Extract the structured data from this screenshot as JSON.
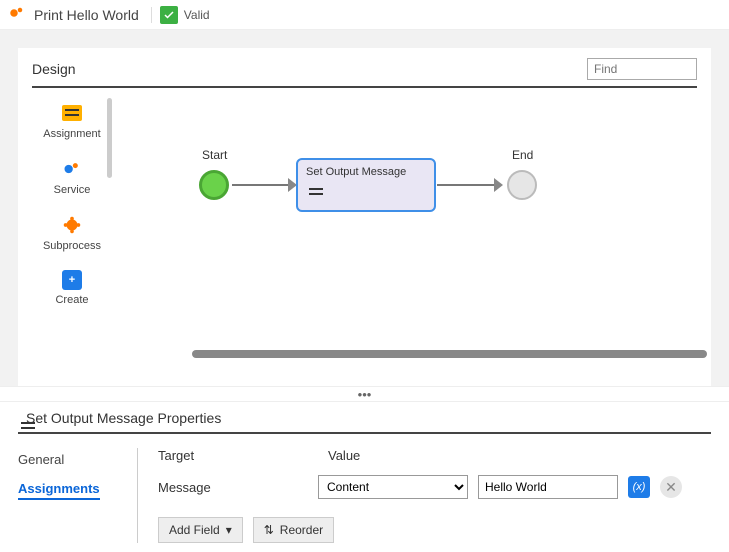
{
  "header": {
    "title": "Print Hello World",
    "valid_label": "Valid"
  },
  "design": {
    "title": "Design",
    "find_placeholder": "Find",
    "palette": [
      {
        "id": "assignment",
        "label": "Assignment"
      },
      {
        "id": "service",
        "label": "Service"
      },
      {
        "id": "subprocess",
        "label": "Subprocess"
      },
      {
        "id": "create",
        "label": "Create"
      }
    ],
    "nodes": {
      "start_label": "Start",
      "task_label": "Set Output Message",
      "end_label": "End"
    }
  },
  "properties": {
    "title": "Set Output Message Properties",
    "tabs": {
      "general": "General",
      "assignments": "Assignments"
    },
    "columns": {
      "target": "Target",
      "value": "Value"
    },
    "row": {
      "target_label": "Message",
      "value_select": "Content",
      "value_text": "Hello World"
    },
    "buttons": {
      "add_field": "Add Field",
      "reorder": "Reorder"
    }
  }
}
